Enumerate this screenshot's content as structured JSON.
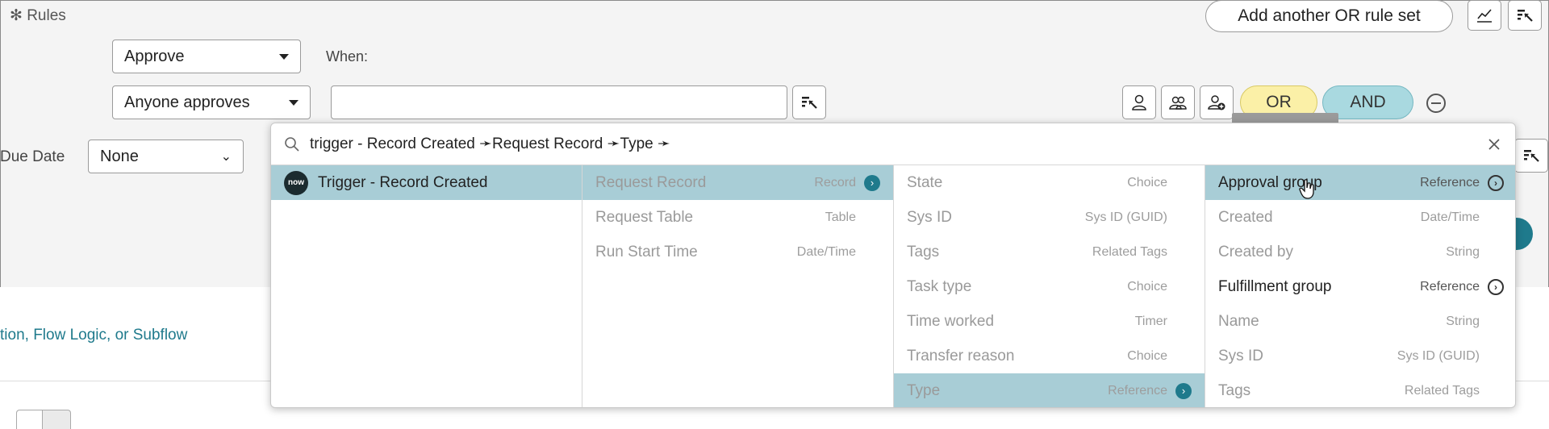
{
  "header": {
    "rules_label": "Rules",
    "add_or_rule_set_label": "Add another OR rule set"
  },
  "rule": {
    "action_select": "Approve",
    "when_label": "When:",
    "condition_select": "Anyone approves",
    "condition_value": "",
    "or_label": "OR",
    "and_label": "AND"
  },
  "due_date": {
    "label": "Due Date",
    "select": "None"
  },
  "tooltip": "Approval group",
  "background_link": "tion, Flow Logic, or Subflow",
  "picker": {
    "search_text": "trigger - Record Created ➛Request Record ➛Type ➛",
    "columns": [
      {
        "rows": [
          {
            "name": "Trigger - Record Created",
            "type": "",
            "logo": "now"
          }
        ]
      },
      {
        "rows": [
          {
            "name": "Request Record",
            "type": "Record"
          },
          {
            "name": "Request Table",
            "type": "Table"
          },
          {
            "name": "Run Start Time",
            "type": "Date/Time"
          }
        ]
      },
      {
        "rows": [
          {
            "name": "State",
            "type": "Choice"
          },
          {
            "name": "Sys ID",
            "type": "Sys ID (GUID)"
          },
          {
            "name": "Tags",
            "type": "Related Tags"
          },
          {
            "name": "Task type",
            "type": "Choice"
          },
          {
            "name": "Time worked",
            "type": "Timer"
          },
          {
            "name": "Transfer reason",
            "type": "Choice"
          },
          {
            "name": "Type",
            "type": "Reference"
          }
        ]
      },
      {
        "rows": [
          {
            "name": "Approval group",
            "type": "Reference"
          },
          {
            "name": "Created",
            "type": "Date/Time"
          },
          {
            "name": "Created by",
            "type": "String"
          },
          {
            "name": "Fulfillment group",
            "type": "Reference"
          },
          {
            "name": "Name",
            "type": "String"
          },
          {
            "name": "Sys ID",
            "type": "Sys ID (GUID)"
          },
          {
            "name": "Tags",
            "type": "Related Tags"
          }
        ]
      }
    ]
  },
  "colors": {
    "selected_row": "#a8cdd6",
    "accent_teal": "#1f7a8c",
    "or_pill": "#fbf0a7",
    "and_pill": "#a9d9e0"
  }
}
